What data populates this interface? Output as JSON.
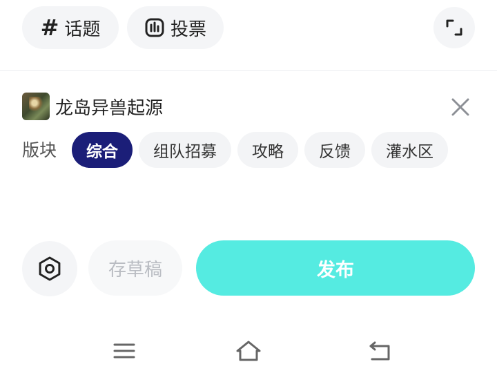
{
  "toolbar": {
    "topic_label": "话题",
    "topic_icon": "hash-icon",
    "poll_label": "投票",
    "poll_icon": "poll-icon",
    "expand_icon": "expand-icon"
  },
  "game": {
    "name": "龙岛异兽起源",
    "avatar_icon": "game-avatar",
    "close_icon": "close-icon"
  },
  "board": {
    "label": "版块",
    "options": [
      "综合",
      "组队招募",
      "攻略",
      "反馈",
      "灌水区"
    ],
    "selected": "综合"
  },
  "actions": {
    "settings_icon": "settings-icon",
    "draft_label": "存草稿",
    "publish_label": "发布"
  },
  "nav": {
    "menu_icon": "menu-icon",
    "home_icon": "home-icon",
    "back_icon": "back-icon"
  },
  "colors": {
    "accent_selected": "#1b1e78",
    "publish": "#55ebe1",
    "chip_bg": "#f3f4f6"
  }
}
